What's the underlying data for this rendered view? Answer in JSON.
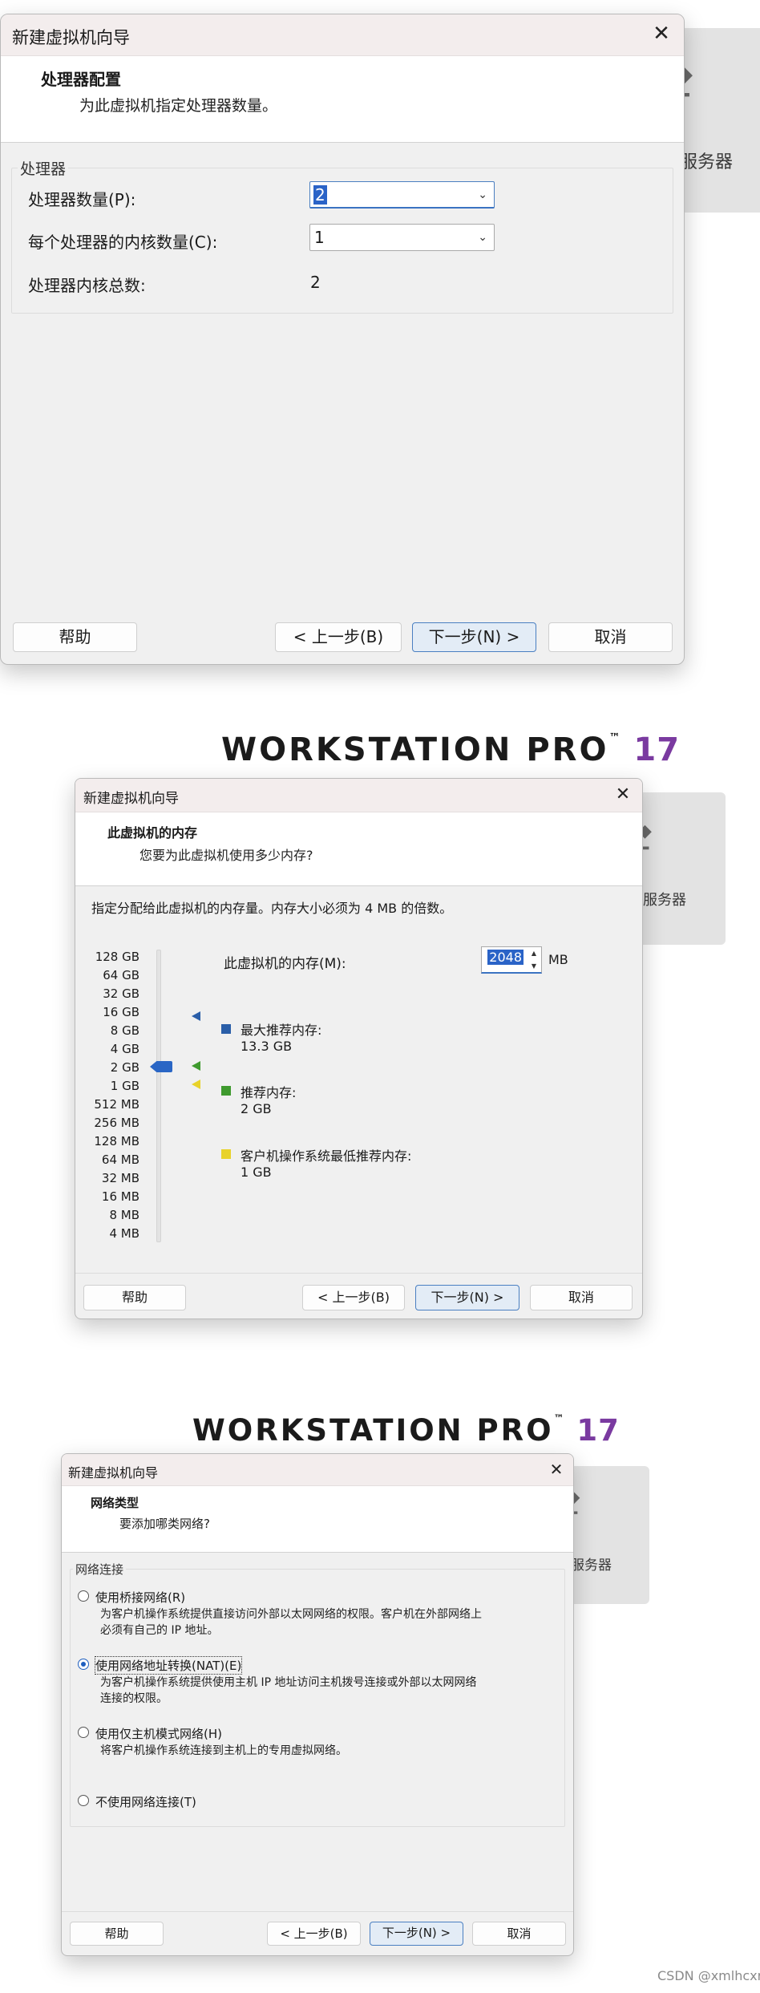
{
  "background": {
    "server_label": "服务器",
    "product_name": "WORKSTATION PRO",
    "product_tm": "™",
    "product_version": "17",
    "watermark": "CSDN @xmlhcxr"
  },
  "wizard_title": "新建虚拟机向导",
  "processor": {
    "header_title": "处理器配置",
    "header_subtitle": "为此虚拟机指定处理器数量。",
    "group_label": "处理器",
    "count_label": "处理器数量(P):",
    "count_value": "2",
    "cores_label": "每个处理器的内核数量(C):",
    "cores_value": "1",
    "total_label": "处理器内核总数:",
    "total_value": "2"
  },
  "memory": {
    "header_title": "此虚拟机的内存",
    "header_subtitle": "您要为此虚拟机使用多少内存?",
    "instruction": "指定分配给此虚拟机的内存量。内存大小必须为 4 MB 的倍数。",
    "scale": [
      "128 GB",
      "64 GB",
      "32 GB",
      "16 GB",
      "8 GB",
      "4 GB",
      "2 GB",
      "1 GB",
      "512 MB",
      "256 MB",
      "128 MB",
      "64 MB",
      "32 MB",
      "16 MB",
      "8 MB",
      "4 MB"
    ],
    "memory_label": "此虚拟机的内存(M):",
    "memory_value": "2048",
    "memory_unit": "MB",
    "max_label": "最大推荐内存:",
    "max_value": "13.3 GB",
    "rec_label": "推荐内存:",
    "rec_value": "2 GB",
    "min_label": "客户机操作系统最低推荐内存:",
    "min_value": "1 GB",
    "colors": {
      "max": "#2a5ea8",
      "rec": "#3f9a2e",
      "min": "#e8d22a",
      "slider": "#2a66c5"
    }
  },
  "network": {
    "header_title": "网络类型",
    "header_subtitle": "要添加哪类网络?",
    "group_label": "网络连接",
    "bridged_label": "使用桥接网络(R)",
    "bridged_desc_1": "为客户机操作系统提供直接访问外部以太网网络的权限。客户机在外部网络上",
    "bridged_desc_2": "必须有自己的 IP 地址。",
    "nat_label": "使用网络地址转换(NAT)(E)",
    "nat_desc_1": "为客户机操作系统提供使用主机 IP 地址访问主机拨号连接或外部以太网网络",
    "nat_desc_2": "连接的权限。",
    "hostonly_label": "使用仅主机模式网络(H)",
    "hostonly_desc": "将客户机操作系统连接到主机上的专用虚拟网络。",
    "none_label": "不使用网络连接(T)",
    "selected": "nat"
  },
  "buttons": {
    "help": "帮助",
    "back": "< 上一步(B)",
    "next": "下一步(N) >",
    "cancel": "取消"
  }
}
